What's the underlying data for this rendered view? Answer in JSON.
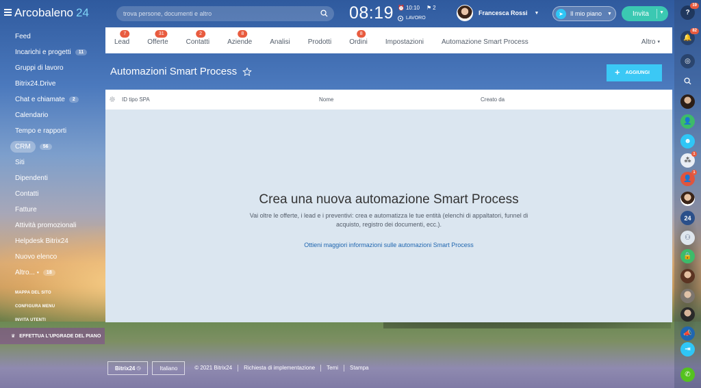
{
  "app": {
    "title": "Arcobaleno",
    "title_num": "24"
  },
  "search": {
    "placeholder": "trova persone, documenti e altro"
  },
  "clock": {
    "time": "08:19",
    "alarm": "10:10",
    "flags": "2",
    "status": "LAVORO"
  },
  "user": {
    "name": "Francesca Rossi"
  },
  "header": {
    "plan_label": "Il mio piano",
    "invite_label": "Invita"
  },
  "sidebar": {
    "items": [
      {
        "label": "Feed",
        "badge": ""
      },
      {
        "label": "Incarichi e progetti",
        "badge": "11"
      },
      {
        "label": "Gruppi di lavoro",
        "badge": ""
      },
      {
        "label": "Bitrix24.Drive",
        "badge": ""
      },
      {
        "label": "Chat e chiamate",
        "badge": "2"
      },
      {
        "label": "Calendario",
        "badge": ""
      },
      {
        "label": "Tempo e rapporti",
        "badge": ""
      },
      {
        "label": "CRM",
        "badge": "56"
      },
      {
        "label": "Siti",
        "badge": ""
      },
      {
        "label": "Dipendenti",
        "badge": ""
      },
      {
        "label": "Contatti",
        "badge": ""
      },
      {
        "label": "Fatture",
        "badge": ""
      },
      {
        "label": "Attività promozionali",
        "badge": ""
      },
      {
        "label": "Helpdesk Bitrix24",
        "badge": ""
      },
      {
        "label": "Nuovo elenco",
        "badge": ""
      },
      {
        "label": "Altro...",
        "badge": "18"
      }
    ],
    "links": [
      "MAPPA DEL SITO",
      "CONFIGURA MENU",
      "INVITA UTENTI"
    ],
    "upgrade_label": "EFFETTUA L'UPGRADE DEL PIANO"
  },
  "tabs": [
    {
      "label": "Lead",
      "count": "7"
    },
    {
      "label": "Offerte",
      "count": "31"
    },
    {
      "label": "Contatti",
      "count": "2"
    },
    {
      "label": "Aziende",
      "count": "8"
    },
    {
      "label": "Analisi",
      "count": ""
    },
    {
      "label": "Prodotti",
      "count": ""
    },
    {
      "label": "Ordini",
      "count": "8"
    },
    {
      "label": "Impostazioni",
      "count": ""
    },
    {
      "label": "Automazione Smart Process",
      "count": ""
    }
  ],
  "tab_more": "Altro",
  "page": {
    "title": "Automazioni Smart Process",
    "add_label": "AGGIUNGI"
  },
  "grid": {
    "columns": [
      "ID tipo SPA",
      "Nome",
      "Creato da"
    ]
  },
  "empty": {
    "heading": "Crea una nuova automazione Smart Process",
    "text": "Vai oltre le offerte, i lead e i preventivi: crea e automatizza le tue entità (elenchi di appaltatori, funnel di acquisto, registro dei documenti, ecc.).",
    "link": "Ottieni maggiori informazioni sulle automazioni Smart Process"
  },
  "footer": {
    "logo": "Bitrix24",
    "lang": "Italiano",
    "links": [
      "© 2021 Bitrix24",
      "Richiesta di implementazione",
      "Temi",
      "Stampa"
    ]
  },
  "rail": {
    "help_badge": "19",
    "bell_badge": "82",
    "avatar_badge": "1",
    "user_badge": "1",
    "num_label": "24"
  },
  "colors": {
    "accent": "#3bc8f5",
    "badge": "#e85b3f",
    "invite": "#3bc8b2",
    "link": "#2067b0"
  }
}
